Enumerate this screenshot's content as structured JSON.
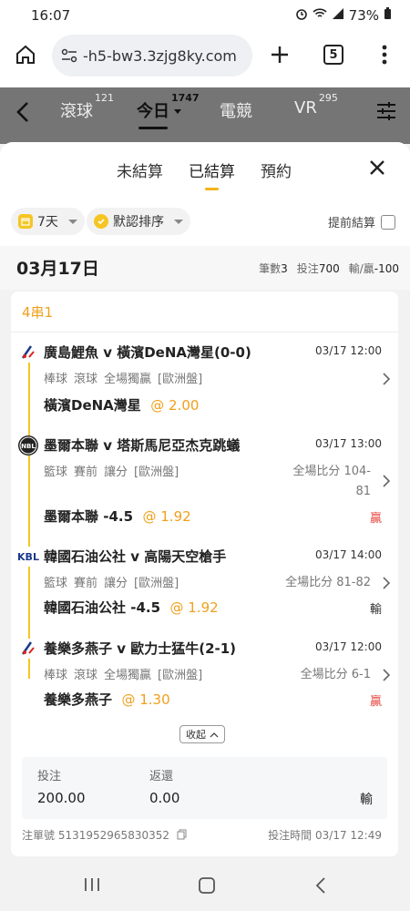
{
  "status_bar": {
    "time": "16:07",
    "battery": "73%"
  },
  "browser": {
    "url": "-h5-bw3.3zjg8ky.com",
    "tab_count": "5"
  },
  "top_nav": {
    "items": [
      {
        "label": "滾球",
        "count": "121"
      },
      {
        "label": "今日",
        "count": "1747"
      },
      {
        "label": "電競",
        "count": ""
      },
      {
        "label": "VR",
        "count": "295"
      }
    ],
    "active": "今日"
  },
  "sheet": {
    "tabs": [
      {
        "label": "未結算"
      },
      {
        "label": "已結算"
      },
      {
        "label": "預約"
      }
    ],
    "active_tab": "已結算"
  },
  "filters": {
    "period": "7天",
    "sort": "默認排序",
    "early_settle_label": "提前結算"
  },
  "date_header": {
    "date": "03月17日",
    "count_label": "筆數",
    "count": "3",
    "stake_label": "投注",
    "stake": "700",
    "winloss_label": "輸/贏",
    "winloss": "-100"
  },
  "bet": {
    "title": "4串1",
    "legs": [
      {
        "teams": "廣島鯉魚 v 橫濱DeNA灣星(0-0)",
        "time": "03/17 12:00",
        "sport": "棒球",
        "phase": "滾球",
        "market": "全場獨贏",
        "odds_type": "[歐洲盤]",
        "score": "",
        "pick": "橫濱DeNA灣星",
        "odds": "@ 2.00",
        "result": "",
        "icon": "npb-logo-icon"
      },
      {
        "teams": "墨爾本聯 v 塔斯馬尼亞杰克跳蟻",
        "time": "03/17 13:00",
        "sport": "籃球",
        "phase": "賽前",
        "market": "讓分",
        "odds_type": "[歐洲盤]",
        "score": "全場比分 104-81",
        "pick": "墨爾本聯 -4.5",
        "odds": "@ 1.92",
        "result": "贏",
        "icon": "nbl-logo-icon"
      },
      {
        "teams": "韓國石油公社 v 高陽天空槍手",
        "time": "03/17 14:00",
        "sport": "籃球",
        "phase": "賽前",
        "market": "讓分",
        "odds_type": "[歐洲盤]",
        "score": "全場比分 81-82",
        "pick": "韓國石油公社 -4.5",
        "odds": "@ 1.92",
        "result": "輸",
        "icon": "kbl-logo-icon"
      },
      {
        "teams": "養樂多燕子 v 歐力士猛牛(2-1)",
        "time": "03/17 12:00",
        "sport": "棒球",
        "phase": "滾球",
        "market": "全場獨贏",
        "odds_type": "[歐洲盤]",
        "score": "全場比分 6-1",
        "pick": "養樂多燕子",
        "odds": "@ 1.30",
        "result": "贏",
        "icon": "npb-logo-icon"
      }
    ],
    "collapse_label": "收起",
    "stake_label": "投注",
    "stake": "200.00",
    "return_label": "返還",
    "return": "0.00",
    "outcome": "輸",
    "ticket_label": "注單號",
    "ticket_no": "5131952965830352",
    "bet_time_label": "投注時間",
    "bet_time": "03/17 12:49"
  },
  "colors": {
    "accent": "#f2b31c",
    "win": "#e5483f",
    "odds": "#f0a01c"
  }
}
